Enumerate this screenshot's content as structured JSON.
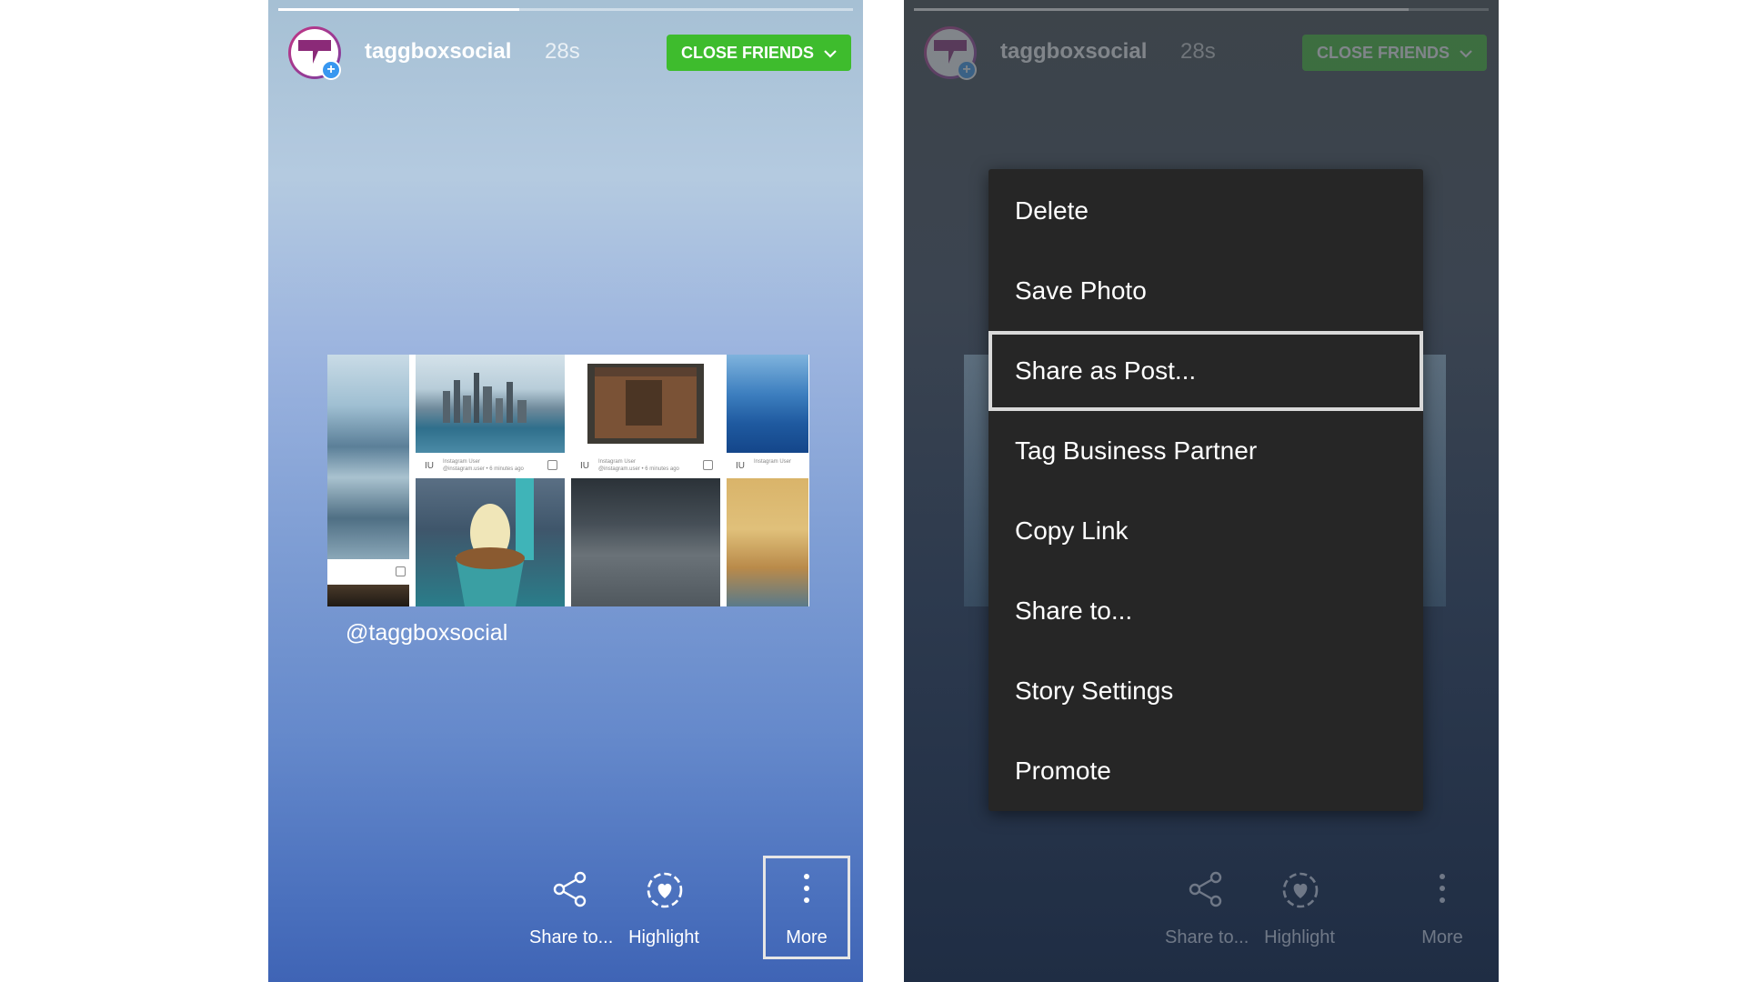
{
  "left": {
    "username": "taggboxsocial",
    "time": "28s",
    "close_friends": "CLOSE FRIENDS",
    "progress_fraction": 0.42,
    "handle": "@taggboxsocial",
    "collage": {
      "meta_initials": "IU",
      "meta_name": "Instagram User",
      "meta_sub": "@instagram.user • 6 minutes ago"
    },
    "actions": {
      "share": "Share to...",
      "highlight": "Highlight",
      "more": "More"
    }
  },
  "right": {
    "username": "taggboxsocial",
    "time": "28s",
    "close_friends": "CLOSE FRIENDS",
    "progress_fraction": 0.86,
    "menu": [
      "Delete",
      "Save Photo",
      "Share as Post...",
      "Tag Business Partner",
      "Copy Link",
      "Share to...",
      "Story Settings",
      "Promote"
    ],
    "highlighted_index": 2,
    "actions": {
      "share": "Share to...",
      "highlight": "Highlight",
      "more": "More"
    }
  },
  "colors": {
    "close_friends_green": "#3ebc2d",
    "menu_bg": "#262626",
    "plus_badge": "#3897f0"
  }
}
